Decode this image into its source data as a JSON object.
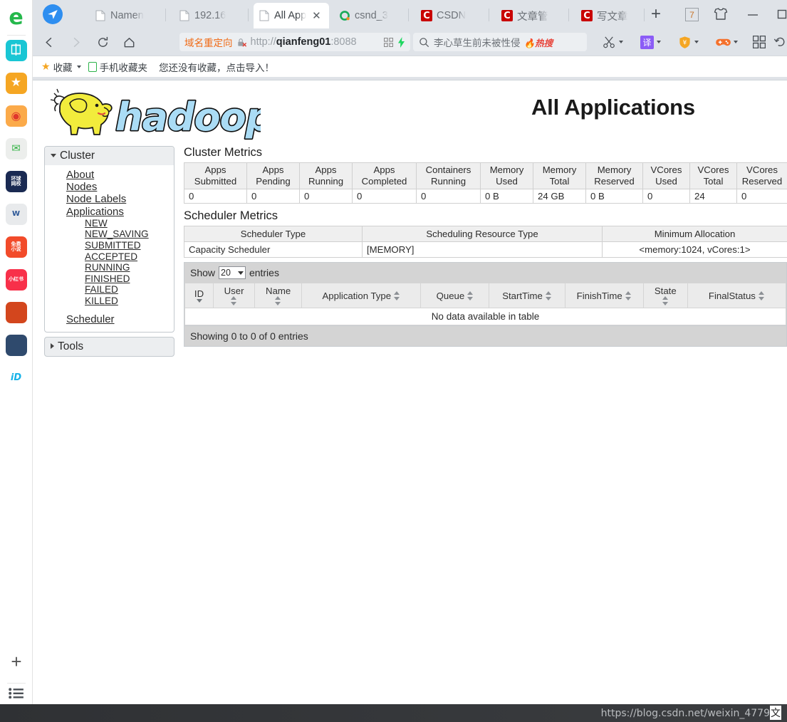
{
  "dock": {
    "browser_logo": "e",
    "items": [
      {
        "name": "quick-add",
        "label": "+",
        "color": "#19c6d4"
      },
      {
        "name": "favorites",
        "label": "★",
        "color": "#f5a623"
      },
      {
        "name": "weibo",
        "label": "◎",
        "color": "#fbaa4a"
      },
      {
        "name": "mail",
        "label": "✉",
        "color": "#e9ece9"
      },
      {
        "name": "global-netease",
        "label": "环球\n网校",
        "color": "#1a2a52"
      },
      {
        "name": "word-doc",
        "label": "W",
        "color": "#e8eaec"
      },
      {
        "name": "free-novel",
        "label": "免费\n小说",
        "color": "#f24b2a"
      },
      {
        "name": "xiaohongshu",
        "label": "小红书",
        "color": "#f8304a"
      },
      {
        "name": "game-one",
        "label": "",
        "color": "#d3461d"
      },
      {
        "name": "game-two",
        "label": "",
        "color": "#2f4a6d"
      },
      {
        "name": "iqiyi",
        "label": "iD",
        "color": "#ffffff"
      }
    ],
    "add_label": "+",
    "list_label": "list"
  },
  "browser": {
    "tabs": [
      {
        "id": "tab-namenode",
        "label": "Namen",
        "favicon": "page",
        "active": false
      },
      {
        "id": "tab-19216",
        "label": "192.16",
        "favicon": "page",
        "active": false
      },
      {
        "id": "tab-all-applications",
        "label": "All App",
        "favicon": "page",
        "active": true,
        "close": "✕"
      },
      {
        "id": "tab-csnd",
        "label": "csnd_3",
        "favicon": "o",
        "active": false
      },
      {
        "id": "tab-csdn",
        "label": "CSDN",
        "favicon": "csdn",
        "active": false
      },
      {
        "id": "tab-article-manage",
        "label": "文章管",
        "favicon": "csdn",
        "active": false
      },
      {
        "id": "tab-write-article",
        "label": "写文章",
        "favicon": "csdn",
        "active": false
      }
    ],
    "new_tab_label": "+",
    "window": {
      "badge_count": "7",
      "skin_icon": "shirt-icon",
      "minimize": "—",
      "maximize": "□",
      "close": "✕"
    },
    "nav": {
      "back": "back-icon",
      "forward": "forward-icon",
      "reload": "reload-icon",
      "home": "home-icon"
    },
    "address": {
      "redirect_tag": "域名重定向",
      "security": "insecure-lock-icon",
      "url_scheme": "http://",
      "url_host": "qianfeng01",
      "url_port": ":8088",
      "qr_icon": "qr-icon",
      "lightning_icon": "lightning-icon"
    },
    "search": {
      "icon": "search-icon",
      "value": "李心草生前未被性侵",
      "badge": "热搜"
    },
    "toolbar": [
      {
        "name": "screenshot-tool",
        "icon": "scissors-icon"
      },
      {
        "name": "translate-tool",
        "icon": "translate-icon",
        "label": "译"
      },
      {
        "name": "coupon-tool",
        "icon": "shield-yuan-icon",
        "label": "¥"
      },
      {
        "name": "game-tool",
        "icon": "gamepad-icon"
      },
      {
        "name": "apps-grid",
        "icon": "grid-icon"
      },
      {
        "name": "history-tool",
        "icon": "undo-icon"
      },
      {
        "name": "main-menu",
        "icon": "hamburger-icon"
      }
    ],
    "bookmarks": {
      "star_label": "收藏",
      "phone_label": "手机收藏夹",
      "hint": "您还没有收藏，点击导入！"
    },
    "status_url": "https://blog.csdn.net/weixin_4779"
  },
  "page": {
    "logo_alt": "hadoop",
    "title": "All Applications",
    "sidebar": {
      "cluster": {
        "heading": "Cluster",
        "links": [
          "About",
          "Nodes",
          "Node Labels",
          "Applications"
        ],
        "states": [
          "NEW",
          "NEW_SAVING",
          "SUBMITTED",
          "ACCEPTED",
          "RUNNING",
          "FINISHED",
          "FAILED",
          "KILLED"
        ],
        "scheduler": "Scheduler"
      },
      "tools": {
        "heading": "Tools"
      }
    },
    "cluster_metrics": {
      "title": "Cluster Metrics",
      "headers": [
        "Apps Submitted",
        "Apps Pending",
        "Apps Running",
        "Apps Completed",
        "Containers Running",
        "Memory Used",
        "Memory Total",
        "Memory Reserved",
        "VCores Used",
        "VCores Total",
        "VCores Reserved"
      ],
      "values": [
        "0",
        "0",
        "0",
        "0",
        "0",
        "0 B",
        "24 GB",
        "0 B",
        "0",
        "24",
        "0"
      ]
    },
    "scheduler_metrics": {
      "title": "Scheduler Metrics",
      "headers": [
        "Scheduler Type",
        "Scheduling Resource Type",
        "Minimum Allocation"
      ],
      "values": [
        "Capacity Scheduler",
        "[MEMORY]",
        "<memory:1024, vCores:1>"
      ]
    },
    "apps_table": {
      "show_label": "Show",
      "page_size": "20",
      "entries_label": "entries",
      "headers": [
        "ID",
        "User",
        "Name",
        "Application Type",
        "Queue",
        "StartTime",
        "FinishTime",
        "State",
        "FinalStatus"
      ],
      "no_data": "No data available in table",
      "showing": "Showing 0 to 0 of 0 entries"
    }
  }
}
